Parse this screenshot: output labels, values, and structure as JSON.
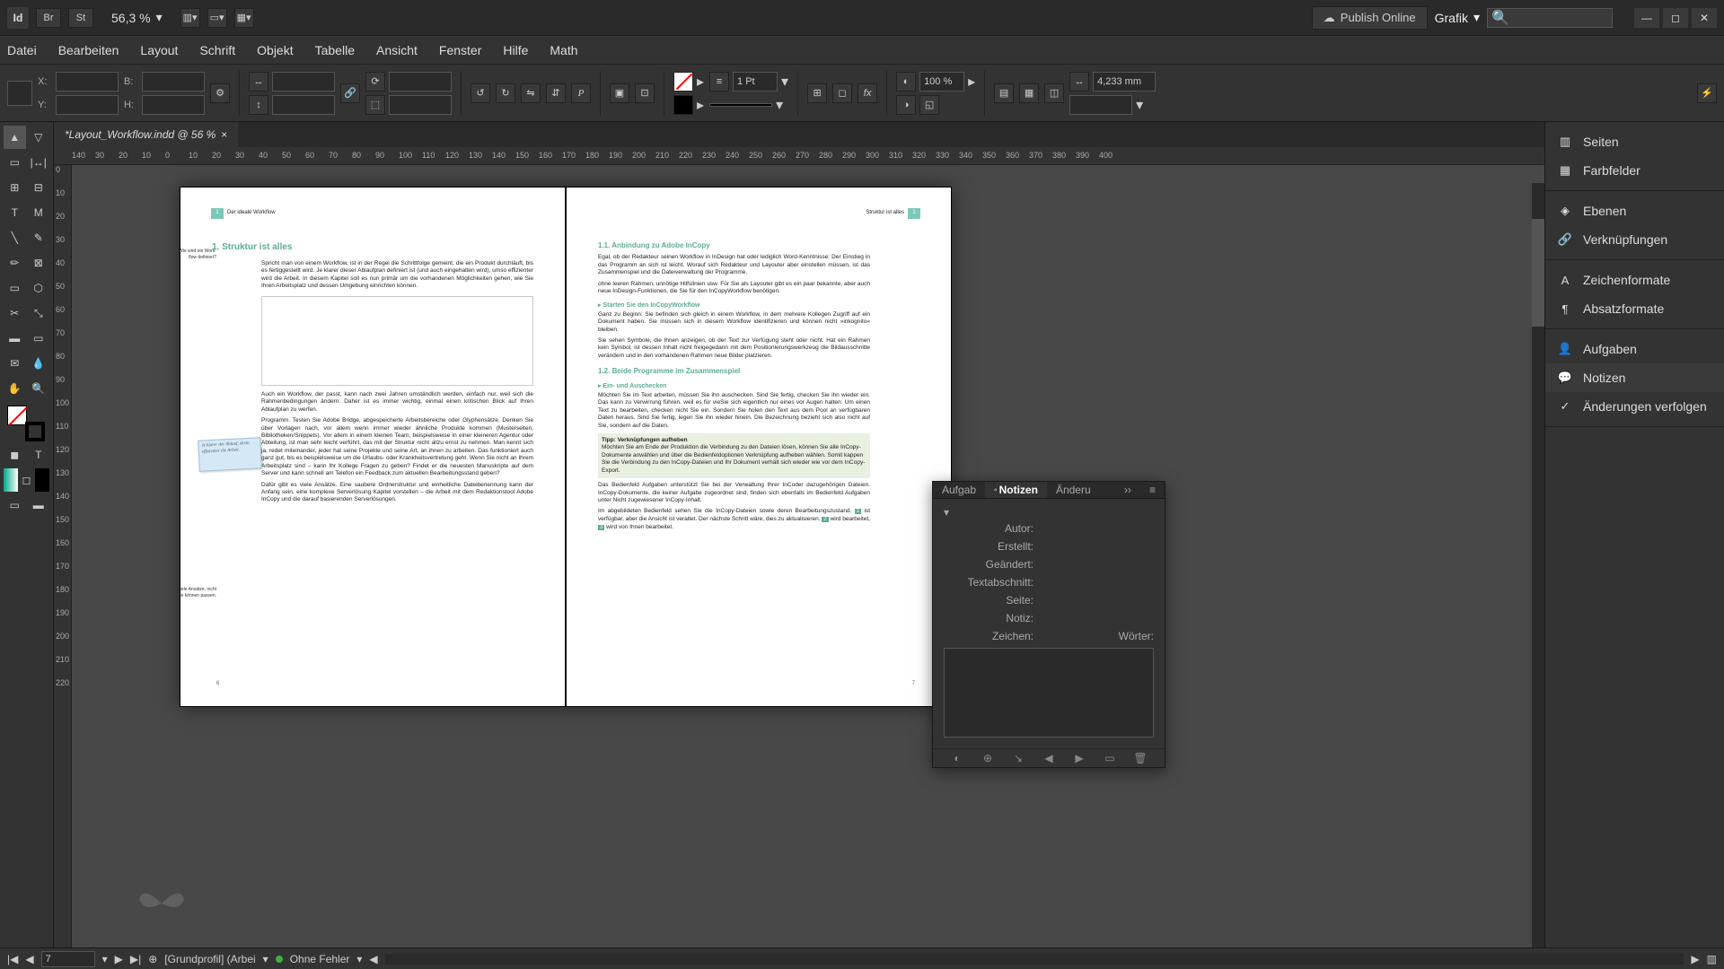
{
  "app": {
    "id_icon": "Id",
    "br": "Br",
    "st": "St",
    "zoom": "56,3 %"
  },
  "titlebar": {
    "publish": "Publish Online",
    "workspace_sel": "Grafik"
  },
  "menu": [
    "Datei",
    "Bearbeiten",
    "Layout",
    "Schrift",
    "Objekt",
    "Tabelle",
    "Ansicht",
    "Fenster",
    "Hilfe",
    "Math"
  ],
  "control": {
    "x": "X:",
    "y": "Y:",
    "w": "B:",
    "h": "H:",
    "stroke": "1 Pt",
    "tint": "100 %",
    "gap": "4,233 mm"
  },
  "tab": {
    "title": "*Layout_Workflow.indd @ 56 %"
  },
  "ruler_h": [
    "140",
    "30",
    "20",
    "10",
    "0",
    "10",
    "20",
    "30",
    "40",
    "50",
    "60",
    "70",
    "80",
    "90",
    "100",
    "110",
    "120",
    "130",
    "140",
    "150",
    "160",
    "170",
    "180",
    "190",
    "200",
    "210",
    "220",
    "230",
    "240",
    "250",
    "260",
    "270",
    "280",
    "290",
    "300",
    "310",
    "320",
    "330",
    "340",
    "350",
    "360",
    "370",
    "380",
    "390",
    "400"
  ],
  "ruler_v": [
    "0",
    "10",
    "20",
    "30",
    "40",
    "50",
    "60",
    "70",
    "80",
    "90",
    "100",
    "110",
    "120",
    "130",
    "140",
    "150",
    "160",
    "170",
    "180",
    "190",
    "200",
    "210",
    "220"
  ],
  "doc": {
    "left_header": {
      "num": "1",
      "text": "Der ideale Workflow"
    },
    "right_header": {
      "text": "Struktur ist alles",
      "num": "1"
    },
    "h1": "1.  Struktur ist alles",
    "margin1": "Wie wird ein Work-flow definiert?",
    "p1": "Spricht man von einem Workflow, ist in der Regel die Schrittfolge gemeint, die ein Produkt durchläuft, bis es fertiggestellt wird. Je klarer dieser Ablaufplan definiert ist (und auch eingehalten wird), umso effizienter wird die Arbeit. In diesem Kapitel soll es nun primär um die vorhandenen Möglichkeiten gehen, wie Sie Ihren Arbeitsplatz und dessen Umgebung einrichten können.",
    "sticky": "Je klarer der Ablauf, desto effizienter die Arbeit.",
    "p2": "Auch ein Workflow, der passt, kann nach zwei Jahren umständlich werden, einfach nur, weil sich die Rahmenbedingungen ändern. Daher ist es immer wichtig, einmal einen kritischen Blick auf Ihren Ablaufplan zu werfen.",
    "p3": "Programm. Testen Sie Adobe Bridge, abgespeicherte Arbeitsbereiche oder Glyphensätze. Denken Sie über Vorlagen nach, vor allem wenn immer wieder ähnliche Produkte kommen (Musterseiten, Bibliotheken/Snippets). Vor allem in einem kleinen Team, beispielsweise in einer kleineren Agentur oder Abteilung, ist man sehr leicht verführt, das mit der Struktur nicht allzu ernst zu nehmen. Man kennt sich ja, redet miteinander, jeder hat seine Projekte und seine Art, an ihnen zu arbeiten. Das funktioniert auch ganz gut, bis es beispielsweise um die Urlaubs- oder Krankheitsvertretung geht. Wenn Sie nicht an Ihrem Arbeitsplatz sind – kann Ihr Kollege Fragen zu geben? Findet er die neuesten Manuskripte auf dem Server und kann schnell am Telefon ein Feedback zum aktuellen Bearbeitungsstand geben?",
    "margin2": "Viele Ansätze, nicht alle können passen.",
    "p4": "Dafür gibt es viele Ansätze. Eine saubere Ordnerstruktur und einheitliche Dateibenennung kann der Anfang sein, eine komplexe Serverlösung Kapitel vorstellen – die Arbeit mit dem Redaktionstool Adobe InCopy und die darauf basierenden Serverlösungen.",
    "left_num": "6",
    "h2_1": "1.1.  Anbindung zu Adobe InCopy",
    "r_p1": "Egal, ob der Redakteur seinen Workflow in InDesign hat oder lediglich Word-Kenntnisse: Der Einstieg in das Programm an sich ist leicht. Worauf sich Redakteur und Layouter aber einstellen müssen, ist das Zusammenspiel und die Dateiverwaltung der Programme.",
    "r_p1b": "ohne leeren Rahmen, unnötige Hilfslinien usw. Für Sie als Layouter gibt es ein paar bekannte, aber auch neue InDesign-Funktionen, die Sie für den InCopyWorkflow benötigen.",
    "h3_1": "▸  Starten Sie den InCopyWorkflow",
    "r_p2": "Ganz zu Beginn: Sie befinden sich gleich in einem Workflow, in dem mehrere Kollegen Zugriff auf ein Dokument haben. Sie müssen sich in diesem Workflow identifizieren und können nicht »inkognito« bleiben.",
    "r_p2b": "Sie sehen Symbole, die Ihnen anzeigen, ob der Text zur Verfügung steht oder nicht. Hat ein Rahmen kein Symbol, ist dessen Inhalt nicht freigegedann mit dem Positionierungswerkzeug die Bildausschnitte verändern und in den vorhandenen Rahmen neue Bilder platzieren.",
    "h2_2": "1.2.  Beide Programme im Zusammenspiel",
    "h3_2": "▸  Ein- und Auschecken",
    "r_p3": "Möchten Sie im Text arbeiten, müssen Sie ihn auschecken. Sind Sie fertig, checken Sie ihn wieder ein. Das kann zu Verwirrung führen, weil es für vieSie sich eigentlich nur eines vor Augen halten: Um einen Text zu bearbeiten, checken nicht Sie ein. Sondern Sie holen den Text aus dem Pool an verfügbaren Daten heraus. Sind Sie fertig, legen Sie ihn wieder hinein. Die Bezeichnung bezieht sich also nicht auf Sie, sondern auf die Daten.",
    "tip_h": "Tipp: Verknüpfungen aufheben",
    "tip_p": "Möchten Sie am Ende der Produktion die Verbindung zu den Dateien lösen, können Sie alle InCopy-Dokumente anwählen und über die Bedienfeldoptionen Verknüpfung aufheben wählen. Somit kappen Sie die Verbindung zu den InCopy-Dateien und Ihr Dokument verhält sich wieder wie vor dem InCopy-Export.",
    "r_p4": "Das Bedienfeld Aufgaben unterstützt Sie bei der Verwaltung Ihrer InCoder dazugehörigen Dateien. InCopy-Dokumente, die keiner Aufgabe zugeordnet sind, finden sich ebenfalls im Bedienfeld Aufgaben unter Nicht zugewiesener InCopy-Inhalt.",
    "r_p5a": "Im abgebildeten Bedienfeld sehen Sie die InCopy-Dateien sowie deren Bearbeitungszustand.",
    "r_p5b": "ist verfügbar, aber die Ansicht ist veraltet. Der nächste Schritt wäre, dies zu aktualisieren.",
    "r_p5c": "wird bearbeitet,",
    "r_p5d": "wird von Ihnen bearbeitet.",
    "badge1": "1",
    "badge2": "2",
    "badge3": "3",
    "right_num": "7"
  },
  "panels": {
    "g1": [
      "Seiten",
      "Farbfelder"
    ],
    "g2": [
      "Ebenen",
      "Verknüpfungen"
    ],
    "g3": [
      "Zeichenformate",
      "Absatzformate"
    ],
    "g4": [
      "Aufgaben",
      "Notizen",
      "Änderungen verfolgen"
    ]
  },
  "notes": {
    "tab1": "Aufgab",
    "tab2": "Notizen",
    "tab3": "Änderu",
    "author": "Autor:",
    "created": "Erstellt:",
    "modified": "Geändert:",
    "story": "Textabschnitt:",
    "page": "Seite:",
    "note": "Notiz:",
    "chars": "Zeichen:",
    "words": "Wörter:"
  },
  "status": {
    "page": "7",
    "profile": "[Grundprofil] (Arbei",
    "errors": "Ohne Fehler"
  }
}
